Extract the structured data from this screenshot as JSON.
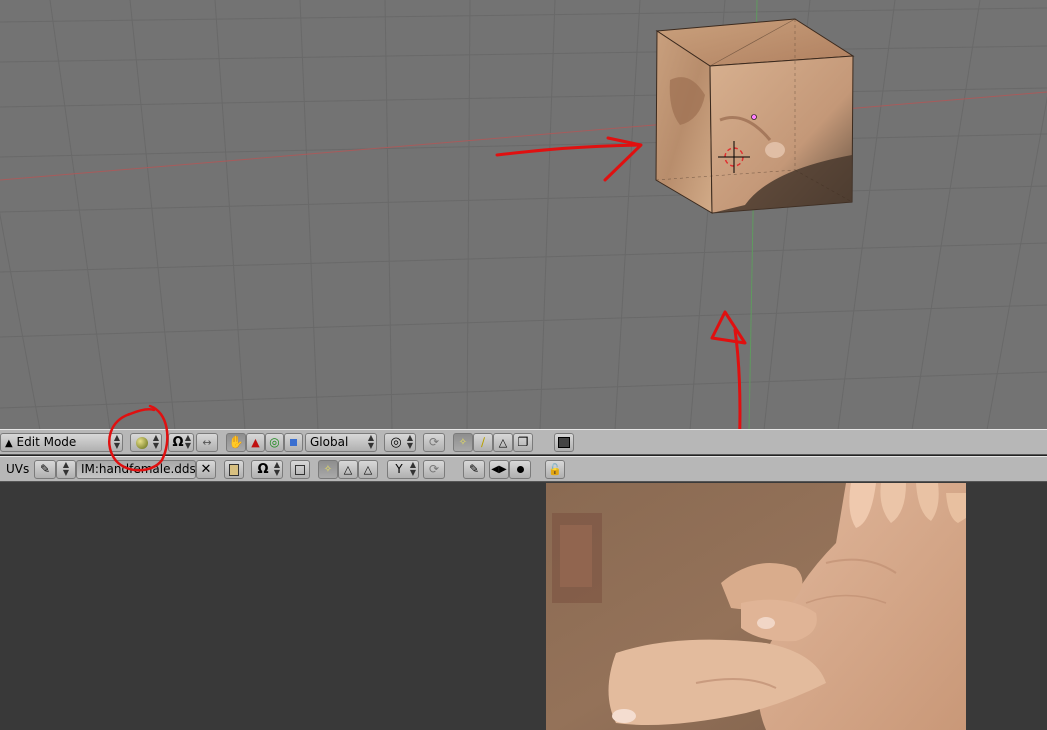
{
  "view3d_header": {
    "mode_label": "Edit Mode",
    "orientation_label": "Global",
    "icons": [
      "mode-triangle-icon",
      "shading-solid-icon",
      "pivot-icon",
      "manipulator-icon",
      "hand-icon",
      "translate-icon",
      "rotate-icon",
      "scale-icon",
      "proportional-icon",
      "snap-icon",
      "vertex-select-icon",
      "edge-select-icon",
      "face-select-icon",
      "occlude-icon",
      "render-icon"
    ]
  },
  "image_header": {
    "menu_label": "UVs",
    "image_name": "IM:handfemale.dds",
    "icons": [
      "pin-icon",
      "browse-image-icon",
      "close-icon",
      "image-icon",
      "pivot-icon",
      "uv-sync-icon",
      "vertex-select-icon",
      "edge-select-icon",
      "face-select-icon",
      "sticky-icon",
      "snap-icon",
      "paint-icon",
      "lock-icon"
    ]
  },
  "colors": {
    "viewport_bg": "#737373",
    "grid": "#6a6a6a",
    "header_bg": "#b7b7b7",
    "image_bg": "#393939",
    "annotation": "#e01010"
  }
}
